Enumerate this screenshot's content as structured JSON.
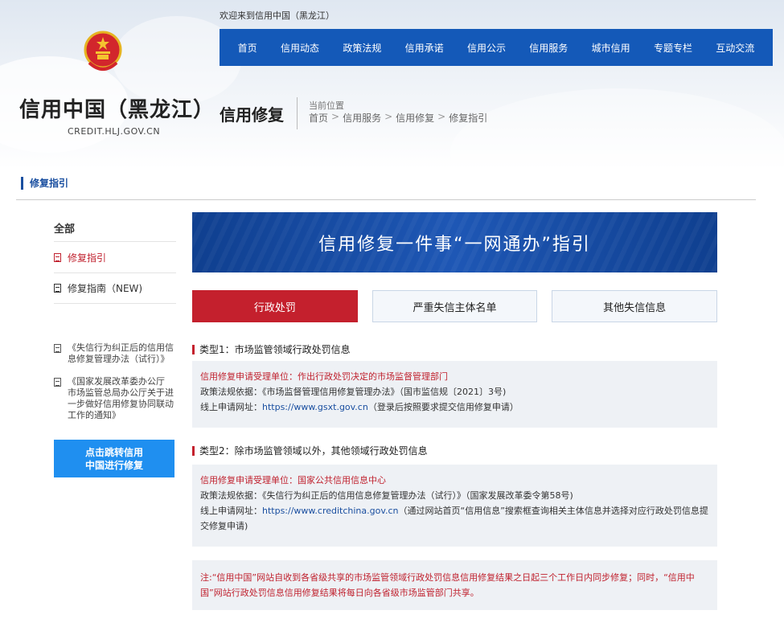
{
  "header": {
    "welcome": "欢迎来到信用中国（黑龙江）",
    "site_name": "信用中国（黑龙江）",
    "site_domain": "CREDIT.HLJ.GOV.CN",
    "nav": [
      "首页",
      "信用动态",
      "政策法规",
      "信用承诺",
      "信用公示",
      "信用服务",
      "城市信用",
      "专题专栏",
      "互动交流"
    ],
    "section_title": "信用修复",
    "crumb_label": "当前位置",
    "breadcrumb": [
      "首页",
      "信用服务",
      "信用修复",
      "修复指引"
    ],
    "breadcrumb_sep": ">"
  },
  "page_heading": "修复指引",
  "sidebar": {
    "all_label": "全部",
    "items": [
      {
        "label": "修复指引",
        "active": true
      },
      {
        "label": "修复指南（NEW)",
        "active": false
      }
    ],
    "links": [
      "《失信行为纠正后的信用信息修复管理办法（试行）》",
      "《国家发展改革委办公厅 市场监管总局办公厅关于进一步做好信用修复协同联动工作的通知》"
    ],
    "button_line1": "点击跳转信用",
    "button_line2": "中国进行修复"
  },
  "banner": "信用修复一件事“一网通办”指引",
  "tabs": [
    {
      "label": "行政处罚",
      "active": true
    },
    {
      "label": "严重失信主体名单",
      "active": false
    },
    {
      "label": "其他失信信息",
      "active": false
    }
  ],
  "type1": {
    "title": "类型1：市场监管领域行政处罚信息",
    "unit": "信用修复申请受理单位：作出行政处罚决定的市场监督管理部门",
    "basis": "政策法规依据：《市场监督管理信用修复管理办法》（国市监信规〔2021〕3号)",
    "url_label": "线上申请网址：",
    "url": "https://www.gsxt.gov.cn",
    "url_note": "（登录后按照要求提交信用修复申请）"
  },
  "type2": {
    "title": "类型2：除市场监管领域以外，其他领域行政处罚信息",
    "unit": "信用修复申请受理单位：国家公共信用信息中心",
    "basis": "政策法规依据：《失信行为纠正后的信用信息修复管理办法（试行）》（国家发展改革委令第58号)",
    "url_label": "线上申请网址：",
    "url": "https://www.creditchina.gov.cn",
    "url_note": "（通过网站首页“信用信息”搜索框查询相关主体信息并选择对应行政处罚信息提交修复申请)"
  },
  "note": "注:“信用中国”网站自收到各省级共享的市场监管领域行政处罚信息信用修复结果之日起三个工作日内同步修复；同时，“信用中国”网站行政处罚信息信用修复结果将每日向各省级市场监管部门共享。",
  "colors": {
    "nav_blue": "#1459b8",
    "accent_red": "#c4202d",
    "button_blue": "#1f8ff0"
  }
}
